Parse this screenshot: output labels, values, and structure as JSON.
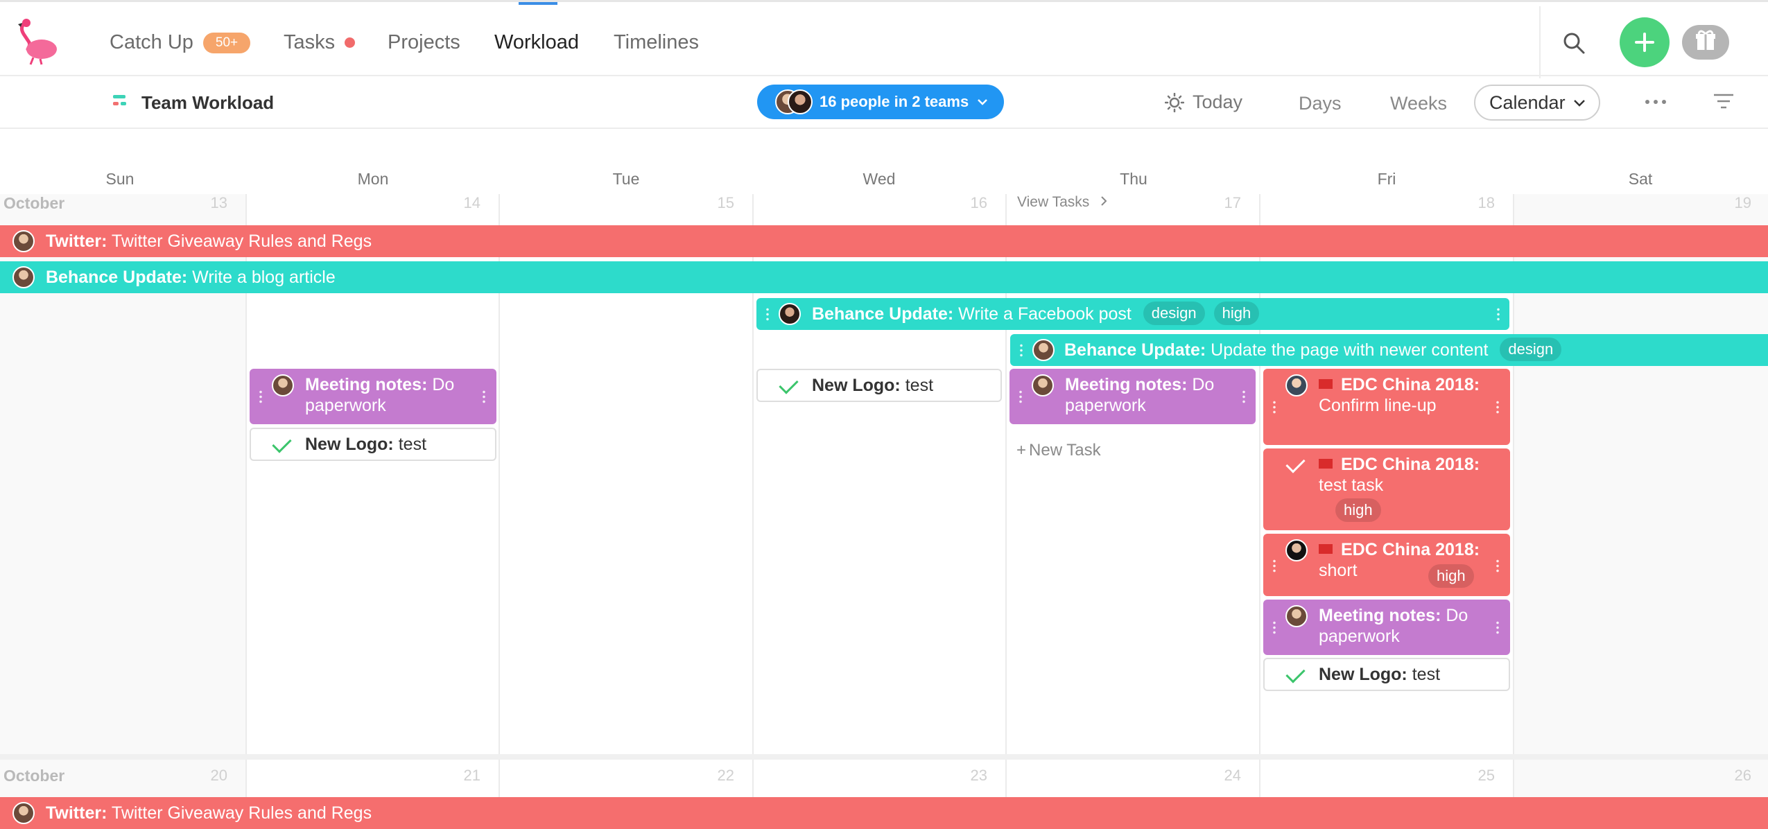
{
  "nav": {
    "tabs": [
      {
        "label": "Catch Up",
        "badge": "50+"
      },
      {
        "label": "Tasks"
      },
      {
        "label": "Projects"
      },
      {
        "label": "Workload",
        "active": true
      },
      {
        "label": "Timelines"
      }
    ],
    "icons": [
      "flamingo-logo",
      "search-icon",
      "plus-icon",
      "gift-icon"
    ],
    "colors": {
      "add": "#4cd37d",
      "gift": "#b5b5b5",
      "active_underline": "#3b8ee6"
    }
  },
  "subheader": {
    "title": "Team Workload",
    "people_filter": "16 people in 2 teams",
    "today": "Today",
    "days": "Days",
    "weeks": "Weeks",
    "view_mode": "Calendar"
  },
  "calendar": {
    "day_names": [
      "Sun",
      "Mon",
      "Tue",
      "Wed",
      "Thu",
      "Fri",
      "Sat"
    ],
    "week1": {
      "month": "October",
      "dates": [
        "13",
        "14",
        "15",
        "16",
        "17",
        "18",
        "19"
      ],
      "view_tasks": "View Tasks"
    },
    "week2": {
      "month": "October",
      "dates": [
        "20",
        "21",
        "22",
        "23",
        "24",
        "25",
        "26"
      ]
    },
    "new_task": "New Task",
    "bars": [
      {
        "title": "Twitter:",
        "text": "Twitter Giveaway Rules and Regs",
        "color": "#f56e6e"
      },
      {
        "title": "Behance Update:",
        "text": "Write a blog article",
        "color": "#2ddbcb"
      },
      {
        "title": "Behance Update:",
        "text": "Write a Facebook post",
        "tags": [
          "design",
          "high"
        ],
        "color": "#2ddbcb"
      },
      {
        "title": "Behance Update:",
        "text": "Update the page with newer content",
        "tags": [
          "design"
        ],
        "color": "#2ddbcb"
      }
    ],
    "cards": {
      "meeting": {
        "title": "Meeting notes:",
        "text": "Do paperwork",
        "color": "#c47bcf"
      },
      "new_logo": {
        "title": "New Logo:",
        "text": "test"
      },
      "edc1": {
        "title": "EDC China 2018:",
        "text": "Confirm line-up"
      },
      "edc2": {
        "title": "EDC China 2018:",
        "text": "test task",
        "tag": "high"
      },
      "edc3": {
        "title": "EDC China 2018:",
        "text": "short",
        "tag": "high"
      }
    },
    "week2_bar": {
      "title": "Twitter:",
      "text": "Twitter Giveaway Rules and Regs"
    }
  }
}
